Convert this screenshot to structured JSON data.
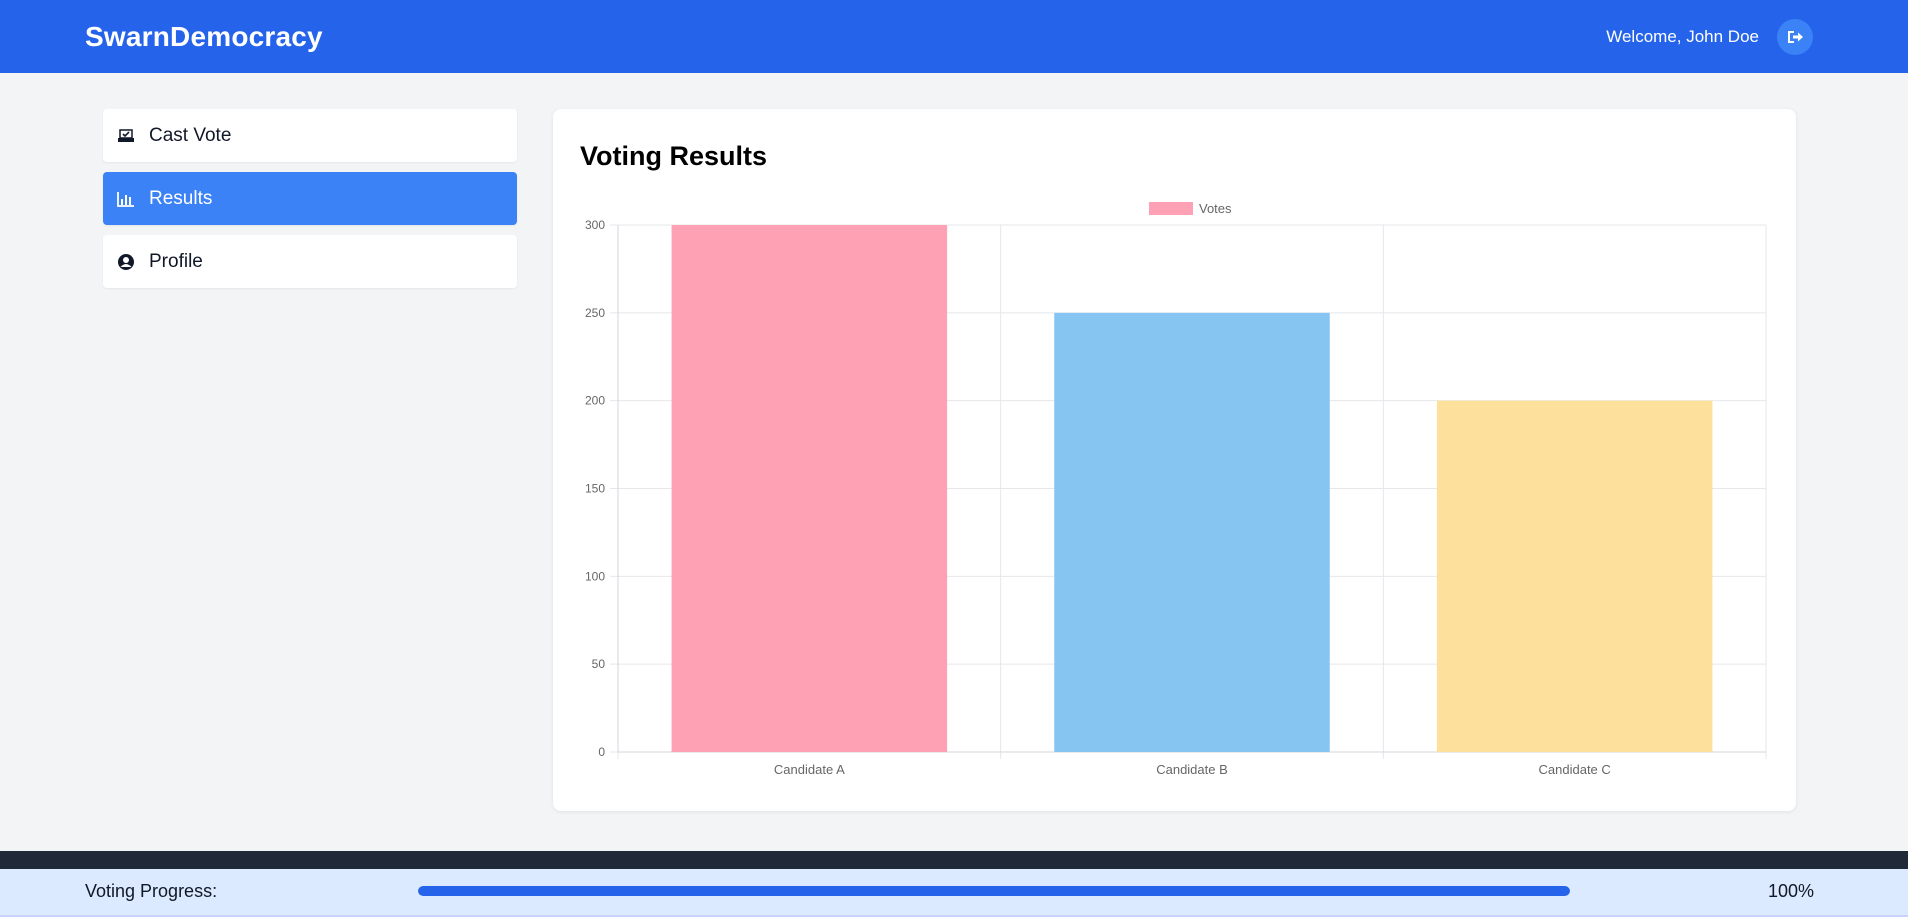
{
  "header": {
    "brand": "SwarnDemocracy",
    "welcome": "Welcome, John Doe",
    "logout_icon": "logout-icon"
  },
  "sidebar": {
    "items": [
      {
        "label": "Cast Vote",
        "icon": "vote-box-icon",
        "active": false
      },
      {
        "label": "Results",
        "icon": "bar-chart-icon",
        "active": true
      },
      {
        "label": "Profile",
        "icon": "user-circle-icon",
        "active": false
      }
    ]
  },
  "main": {
    "title": "Voting Results"
  },
  "chart_data": {
    "type": "bar",
    "categories": [
      "Candidate A",
      "Candidate B",
      "Candidate C"
    ],
    "series": [
      {
        "name": "Votes",
        "values": [
          300,
          250,
          200
        ]
      }
    ],
    "colors": [
      "#ffa1b5",
      "#86c5f2",
      "#fde09b"
    ],
    "legend_color": "#ffa1b5",
    "ylim": [
      0,
      300
    ],
    "yticks": [
      0,
      50,
      100,
      150,
      200,
      250,
      300
    ],
    "grid": true,
    "legend": "top-center"
  },
  "footer": {
    "progress_label": "Voting Progress:",
    "progress_value": 100,
    "progress_text": "100%"
  },
  "colors": {
    "primary": "#2563eb",
    "active_nav": "#3b82f6",
    "footer_dark": "#1f2937",
    "footer_light": "#dbeafe"
  }
}
